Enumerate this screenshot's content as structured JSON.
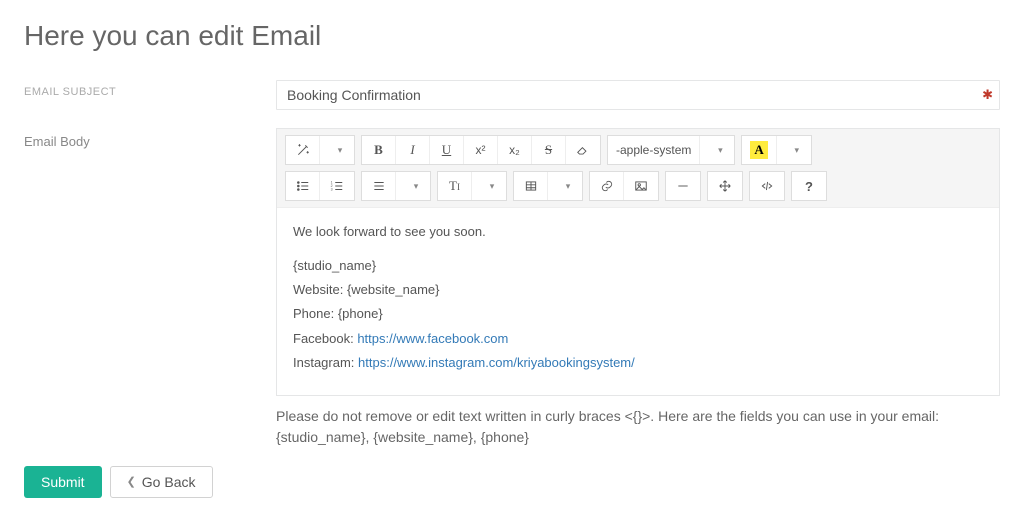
{
  "page_title": "Here you can edit Email",
  "labels": {
    "subject": "Email Subject",
    "body": "Email Body"
  },
  "subject_value": "Booking Confirmation",
  "toolbar": {
    "font_family": "-apple-system",
    "font_color_glyph": "A"
  },
  "editor": {
    "line_intro": "We look forward to see you soon.",
    "line_studio": "{studio_name}",
    "line_website_label": "Website: ",
    "line_website_value": "{website_name}",
    "line_phone_label": "Phone: ",
    "line_phone_value": "{phone}",
    "line_fb_label": "Facebook: ",
    "line_fb_url": "https://www.facebook.com",
    "line_ig_label": "Instagram:  ",
    "line_ig_url": "https://www.instagram.com/kriyabookingsystem/"
  },
  "help_text": "Please do not remove or edit text written in curly braces <{}>. Here are the fields you can use in your email: {studio_name}, {website_name}, {phone}",
  "buttons": {
    "submit": "Submit",
    "go_back": "Go Back"
  }
}
